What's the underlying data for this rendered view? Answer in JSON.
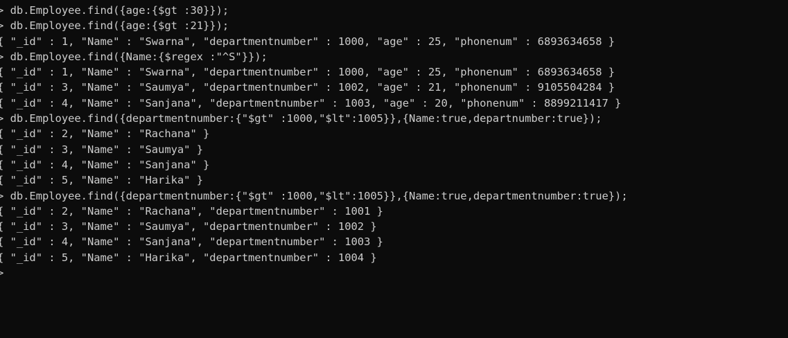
{
  "terminal": {
    "lines": [
      "> db.Employee.find({age:{$gt :30}});",
      "> db.Employee.find({age:{$gt :21}});",
      "{ \"_id\" : 1, \"Name\" : \"Swarna\", \"departmentnumber\" : 1000, \"age\" : 25, \"phonenum\" : 6893634658 }",
      "> db.Employee.find({Name:{$regex :\"^S\"}});",
      "{ \"_id\" : 1, \"Name\" : \"Swarna\", \"departmentnumber\" : 1000, \"age\" : 25, \"phonenum\" : 6893634658 }",
      "{ \"_id\" : 3, \"Name\" : \"Saumya\", \"departmentnumber\" : 1002, \"age\" : 21, \"phonenum\" : 9105504284 }",
      "{ \"_id\" : 4, \"Name\" : \"Sanjana\", \"departmentnumber\" : 1003, \"age\" : 20, \"phonenum\" : 8899211417 }",
      "> db.Employee.find({departmentnumber:{\"$gt\" :1000,\"$lt\":1005}},{Name:true,departnumber:true});",
      "{ \"_id\" : 2, \"Name\" : \"Rachana\" }",
      "{ \"_id\" : 3, \"Name\" : \"Saumya\" }",
      "{ \"_id\" : 4, \"Name\" : \"Sanjana\" }",
      "{ \"_id\" : 5, \"Name\" : \"Harika\" }",
      "> db.Employee.find({departmentnumber:{\"$gt\" :1000,\"$lt\":1005}},{Name:true,departmentnumber:true});",
      "{ \"_id\" : 2, \"Name\" : \"Rachana\", \"departmentnumber\" : 1001 }",
      "{ \"_id\" : 3, \"Name\" : \"Saumya\", \"departmentnumber\" : 1002 }",
      "{ \"_id\" : 4, \"Name\" : \"Sanjana\", \"departmentnumber\" : 1003 }",
      "{ \"_id\" : 5, \"Name\" : \"Harika\", \"departmentnumber\" : 1004 }",
      ">"
    ]
  },
  "colors": {
    "background": "#0c0c0c",
    "text": "#cccccc"
  }
}
